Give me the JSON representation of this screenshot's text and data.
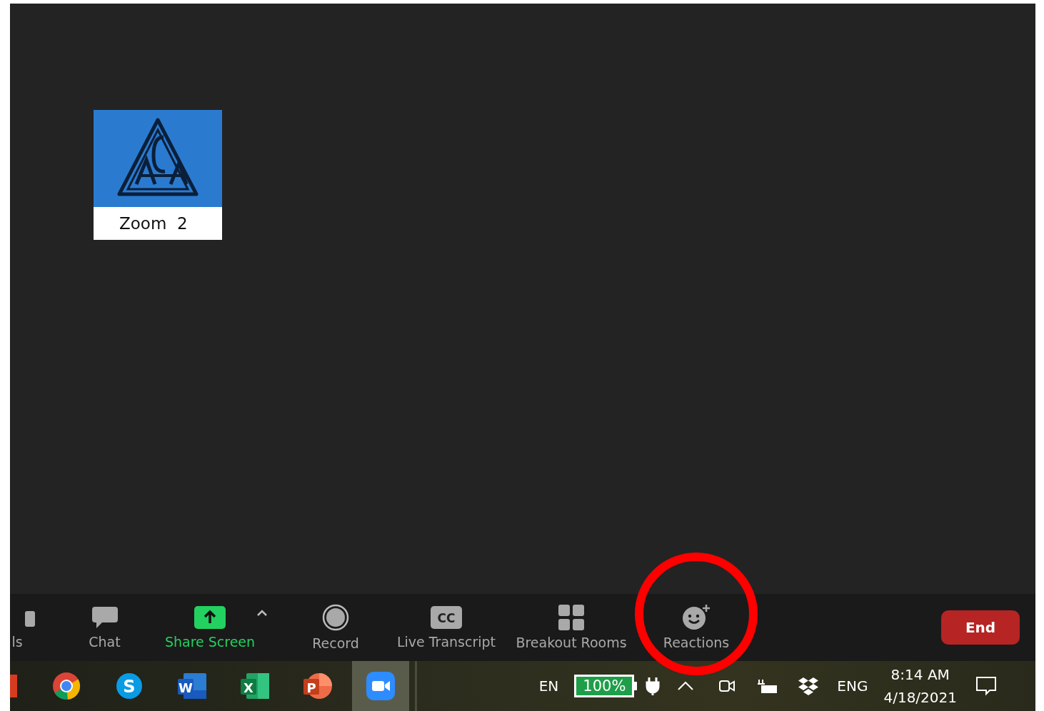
{
  "meeting": {
    "participant_tile": {
      "name": "Zoom  2"
    }
  },
  "toolbar": {
    "items": [
      {
        "kind": "participants",
        "label": "ls",
        "highlighted": false
      },
      {
        "kind": "chat",
        "label": "Chat",
        "highlighted": false
      },
      {
        "kind": "share",
        "label": "Share Screen",
        "highlighted": false
      },
      {
        "kind": "record",
        "label": "Record",
        "highlighted": false
      },
      {
        "kind": "transcript",
        "label": "Live Transcript",
        "icon_text": "CC",
        "highlighted": false
      },
      {
        "kind": "breakout",
        "label": "Breakout Rooms",
        "highlighted": false
      },
      {
        "kind": "reactions",
        "label": "Reactions",
        "highlighted": true
      }
    ],
    "end_button": "End"
  },
  "taskbar": {
    "apps": [
      {
        "kind": "office",
        "selected": false
      },
      {
        "kind": "chrome",
        "selected": false
      },
      {
        "kind": "skype",
        "letter": "S",
        "selected": false
      },
      {
        "kind": "word",
        "letter": "W",
        "selected": false
      },
      {
        "kind": "excel",
        "letter": "X",
        "selected": false
      },
      {
        "kind": "powerpoint",
        "letter": "P",
        "selected": false
      },
      {
        "kind": "zoom",
        "selected": true
      }
    ],
    "tray": {
      "input_language": "EN",
      "battery": "100%",
      "keyboard_language": "ENG",
      "time": "8:14 AM",
      "date": "4/18/2021"
    }
  }
}
